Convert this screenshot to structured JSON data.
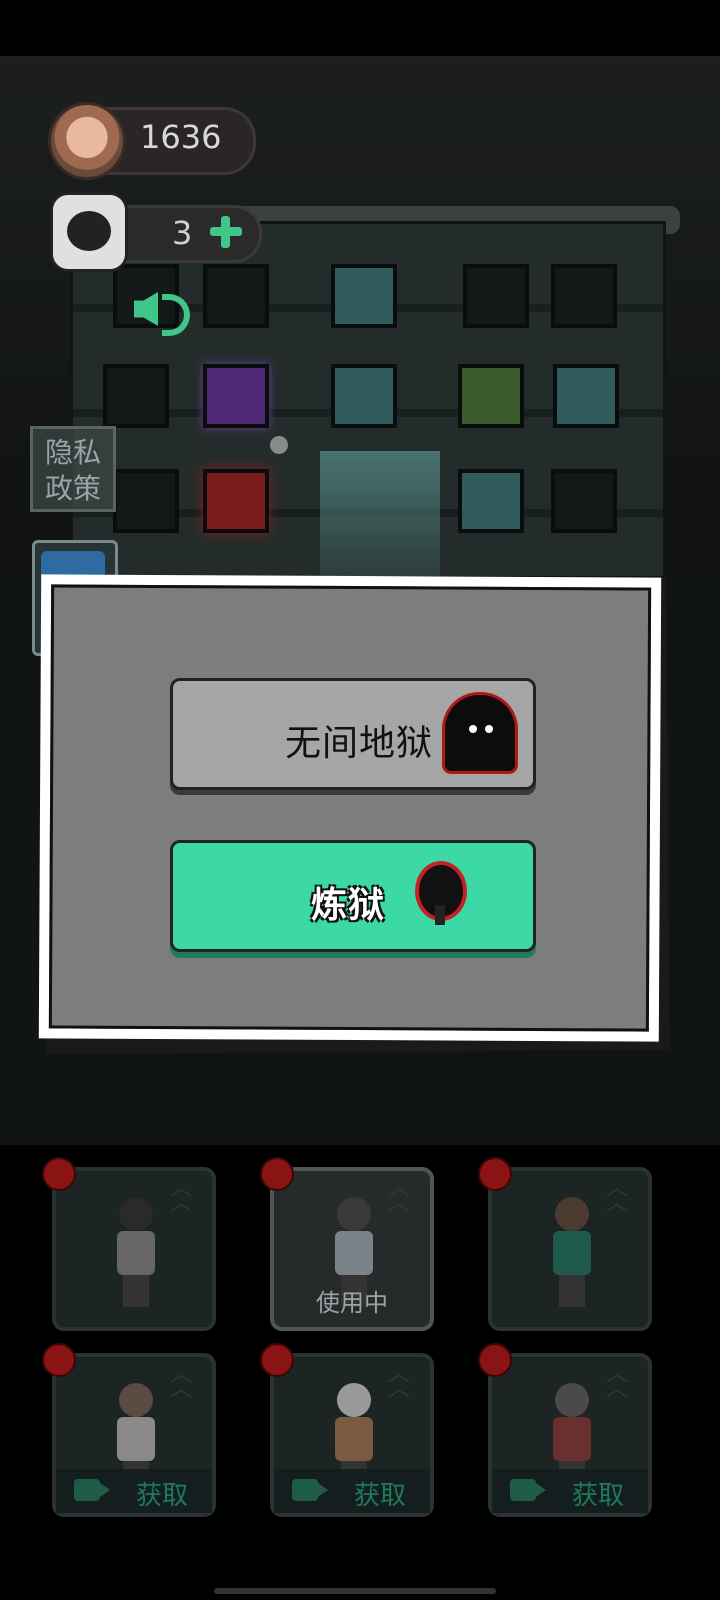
{
  "hud": {
    "coins": "1636",
    "puzzle_pieces": "3",
    "coin_icon": "pig-coin-icon",
    "puzzle_icon": "puzzle-ghost-icon",
    "add_icon": "plus-icon",
    "sound_icon": "speaker-icon"
  },
  "side": {
    "privacy_label_line1": "隐私",
    "privacy_label_line2": "政策"
  },
  "dialog": {
    "options": [
      {
        "label": "无间地狱",
        "icon": "ghost-icon",
        "color": "#a6a6a6"
      },
      {
        "label": "炼狱",
        "icon": "demon-icon",
        "color": "#3cd8a6"
      }
    ]
  },
  "characters": {
    "cards": [
      {
        "status": "",
        "locked": false
      },
      {
        "status": "使用中",
        "locked": false
      },
      {
        "status": "",
        "locked": false
      },
      {
        "status": "获取",
        "locked": true
      },
      {
        "status": "获取",
        "locked": true
      },
      {
        "status": "获取",
        "locked": true
      }
    ]
  },
  "colors": {
    "accent_green": "#3cd8a6",
    "badge_red": "#8a1414"
  }
}
